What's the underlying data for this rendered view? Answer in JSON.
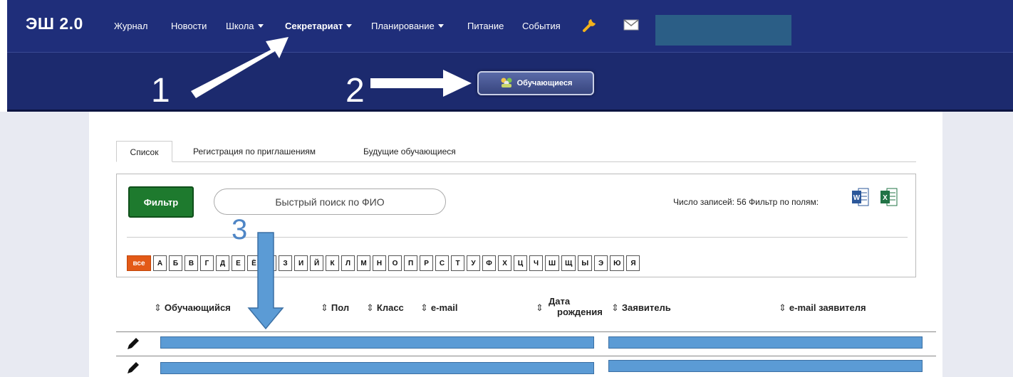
{
  "nav": {
    "brand": "ЭШ 2.0",
    "items": [
      {
        "label": "Журнал",
        "dropdown": false,
        "active": false
      },
      {
        "label": "Новости",
        "dropdown": false,
        "active": false
      },
      {
        "label": "Школа",
        "dropdown": true,
        "active": false
      },
      {
        "label": "Секретариат",
        "dropdown": true,
        "active": true
      },
      {
        "label": "Планирование",
        "dropdown": true,
        "active": false
      },
      {
        "label": "Питание",
        "dropdown": false,
        "active": false
      },
      {
        "label": "События",
        "dropdown": false,
        "active": false
      }
    ],
    "icons": [
      "wrench-icon",
      "mail-icon"
    ]
  },
  "subnav": {
    "button_label": "Обучающиеся",
    "button_icon": "people-icon"
  },
  "annotations": {
    "step1": "1",
    "step2": "2",
    "step3": "3"
  },
  "tabs": [
    {
      "label": "Список",
      "active": true
    },
    {
      "label": "Регистрация по приглашениям",
      "active": false
    },
    {
      "label": "Будущие обучающиеся",
      "active": false
    }
  ],
  "filter": {
    "button_label": "Фильтр",
    "search_placeholder": "Быстрый поиск по ФИО",
    "records_text": "Число записей: 56 Фильтр по полям:",
    "export_icons": [
      "word-icon",
      "excel-icon"
    ]
  },
  "letters": [
    "все",
    "А",
    "Б",
    "В",
    "Г",
    "Д",
    "Е",
    "Ё",
    "Ж",
    "З",
    "И",
    "Й",
    "К",
    "Л",
    "М",
    "Н",
    "О",
    "П",
    "Р",
    "С",
    "Т",
    "У",
    "Ф",
    "Х",
    "Ц",
    "Ч",
    "Ш",
    "Щ",
    "Ы",
    "Э",
    "Ю",
    "Я"
  ],
  "table": {
    "sort_glyph": "⇕",
    "columns": {
      "student": "Обучающийся",
      "gender": "Пол",
      "class": "Класс",
      "email": "e-mail",
      "birth_line1": "Дата",
      "birth_line2": "рождения",
      "applicant": "Заявитель",
      "applicant_email": "e-mail заявителя"
    }
  },
  "colors": {
    "nav_bg": "#1f2e7a",
    "subnav_bg": "#1c2a6e",
    "filter_green": "#1e7a2e",
    "all_orange": "#e35a17",
    "annotation_blue": "#4f86c6"
  }
}
